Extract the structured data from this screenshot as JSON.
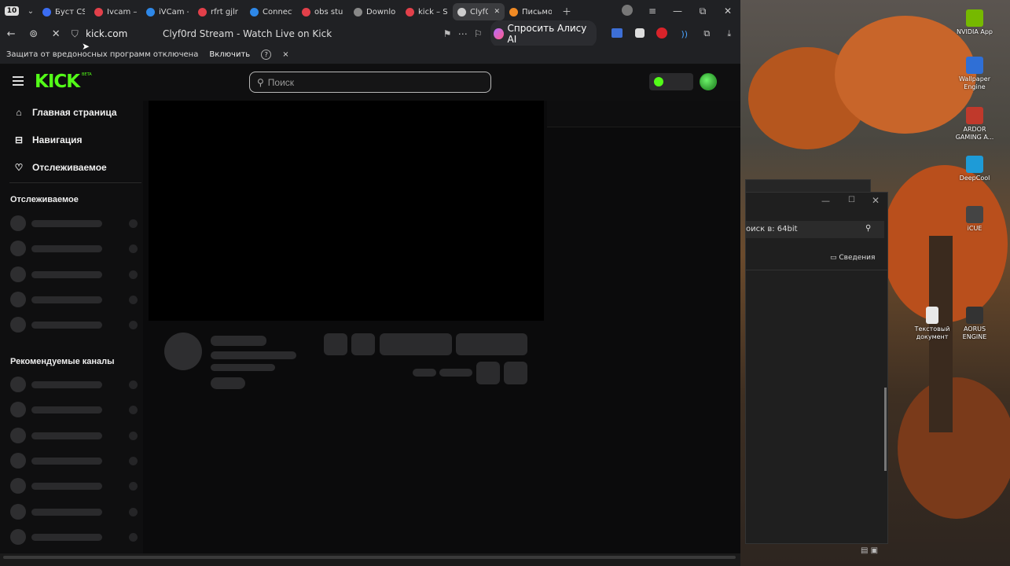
{
  "tabs": [
    {
      "title": "Буст CS",
      "color": "#3b6df2",
      "active": false
    },
    {
      "title": "Ivcam –",
      "color": "#e2404a",
      "active": false
    },
    {
      "title": "iVCam -",
      "color": "#2e88e8",
      "active": false
    },
    {
      "title": "rfrt gjlr",
      "color": "#e2404a",
      "active": false
    },
    {
      "title": "Connect",
      "color": "#2e88e8",
      "active": false
    },
    {
      "title": "obs stu",
      "color": "#e2404a",
      "active": false
    },
    {
      "title": "Downlo",
      "color": "#888888",
      "active": false
    },
    {
      "title": "kick – S",
      "color": "#e2404a",
      "active": false
    },
    {
      "title": "Clyf0",
      "color": "#cccccc",
      "active": true
    },
    {
      "title": "Письмо",
      "color": "#f08a24",
      "active": false
    }
  ],
  "tab_counter": "10",
  "address": {
    "url": "kick.com",
    "page_title": "Clyf0rd Stream - Watch Live on Kick",
    "alice_label": "Спросить Алису AI"
  },
  "infobar": {
    "message": "Защита от вредоносных программ отключена",
    "enable_label": "Включить",
    "help": "?",
    "close": "×"
  },
  "kick": {
    "logo": "KICK",
    "logo_badge": "BETA",
    "search_placeholder": "Поиск",
    "nav": [
      {
        "label": "Главная страница",
        "icon": "home-icon"
      },
      {
        "label": "Навигация",
        "icon": "compass-icon"
      },
      {
        "label": "Отслеживаемое",
        "icon": "heart-icon"
      }
    ],
    "following_heading": "Отслеживаемое",
    "recommended_heading": "Рекомендуемые каналы"
  },
  "desktop": {
    "icons": [
      {
        "label": "NVIDIA App",
        "color": "#76b900"
      },
      {
        "label": "Wallpaper Engine",
        "color": "#2f6fd6"
      },
      {
        "label": "ARDOR GAMING A...",
        "color": "#c0392b"
      },
      {
        "label": "DeepCool",
        "color": "#1e9bd7"
      },
      {
        "label": "iCUE",
        "color": "#444444"
      },
      {
        "label": "Текстовый документ",
        "color": "#e8e8e8"
      },
      {
        "label": "AORUS ENGINE",
        "color": "#333333"
      }
    ],
    "explorer_search": "оиск в: 64bit",
    "explorer_details": "Сведения"
  },
  "colors": {
    "kick_green": "#53fc18",
    "page_bg": "#0b0b0c",
    "skeleton": "#2b2b2d"
  }
}
